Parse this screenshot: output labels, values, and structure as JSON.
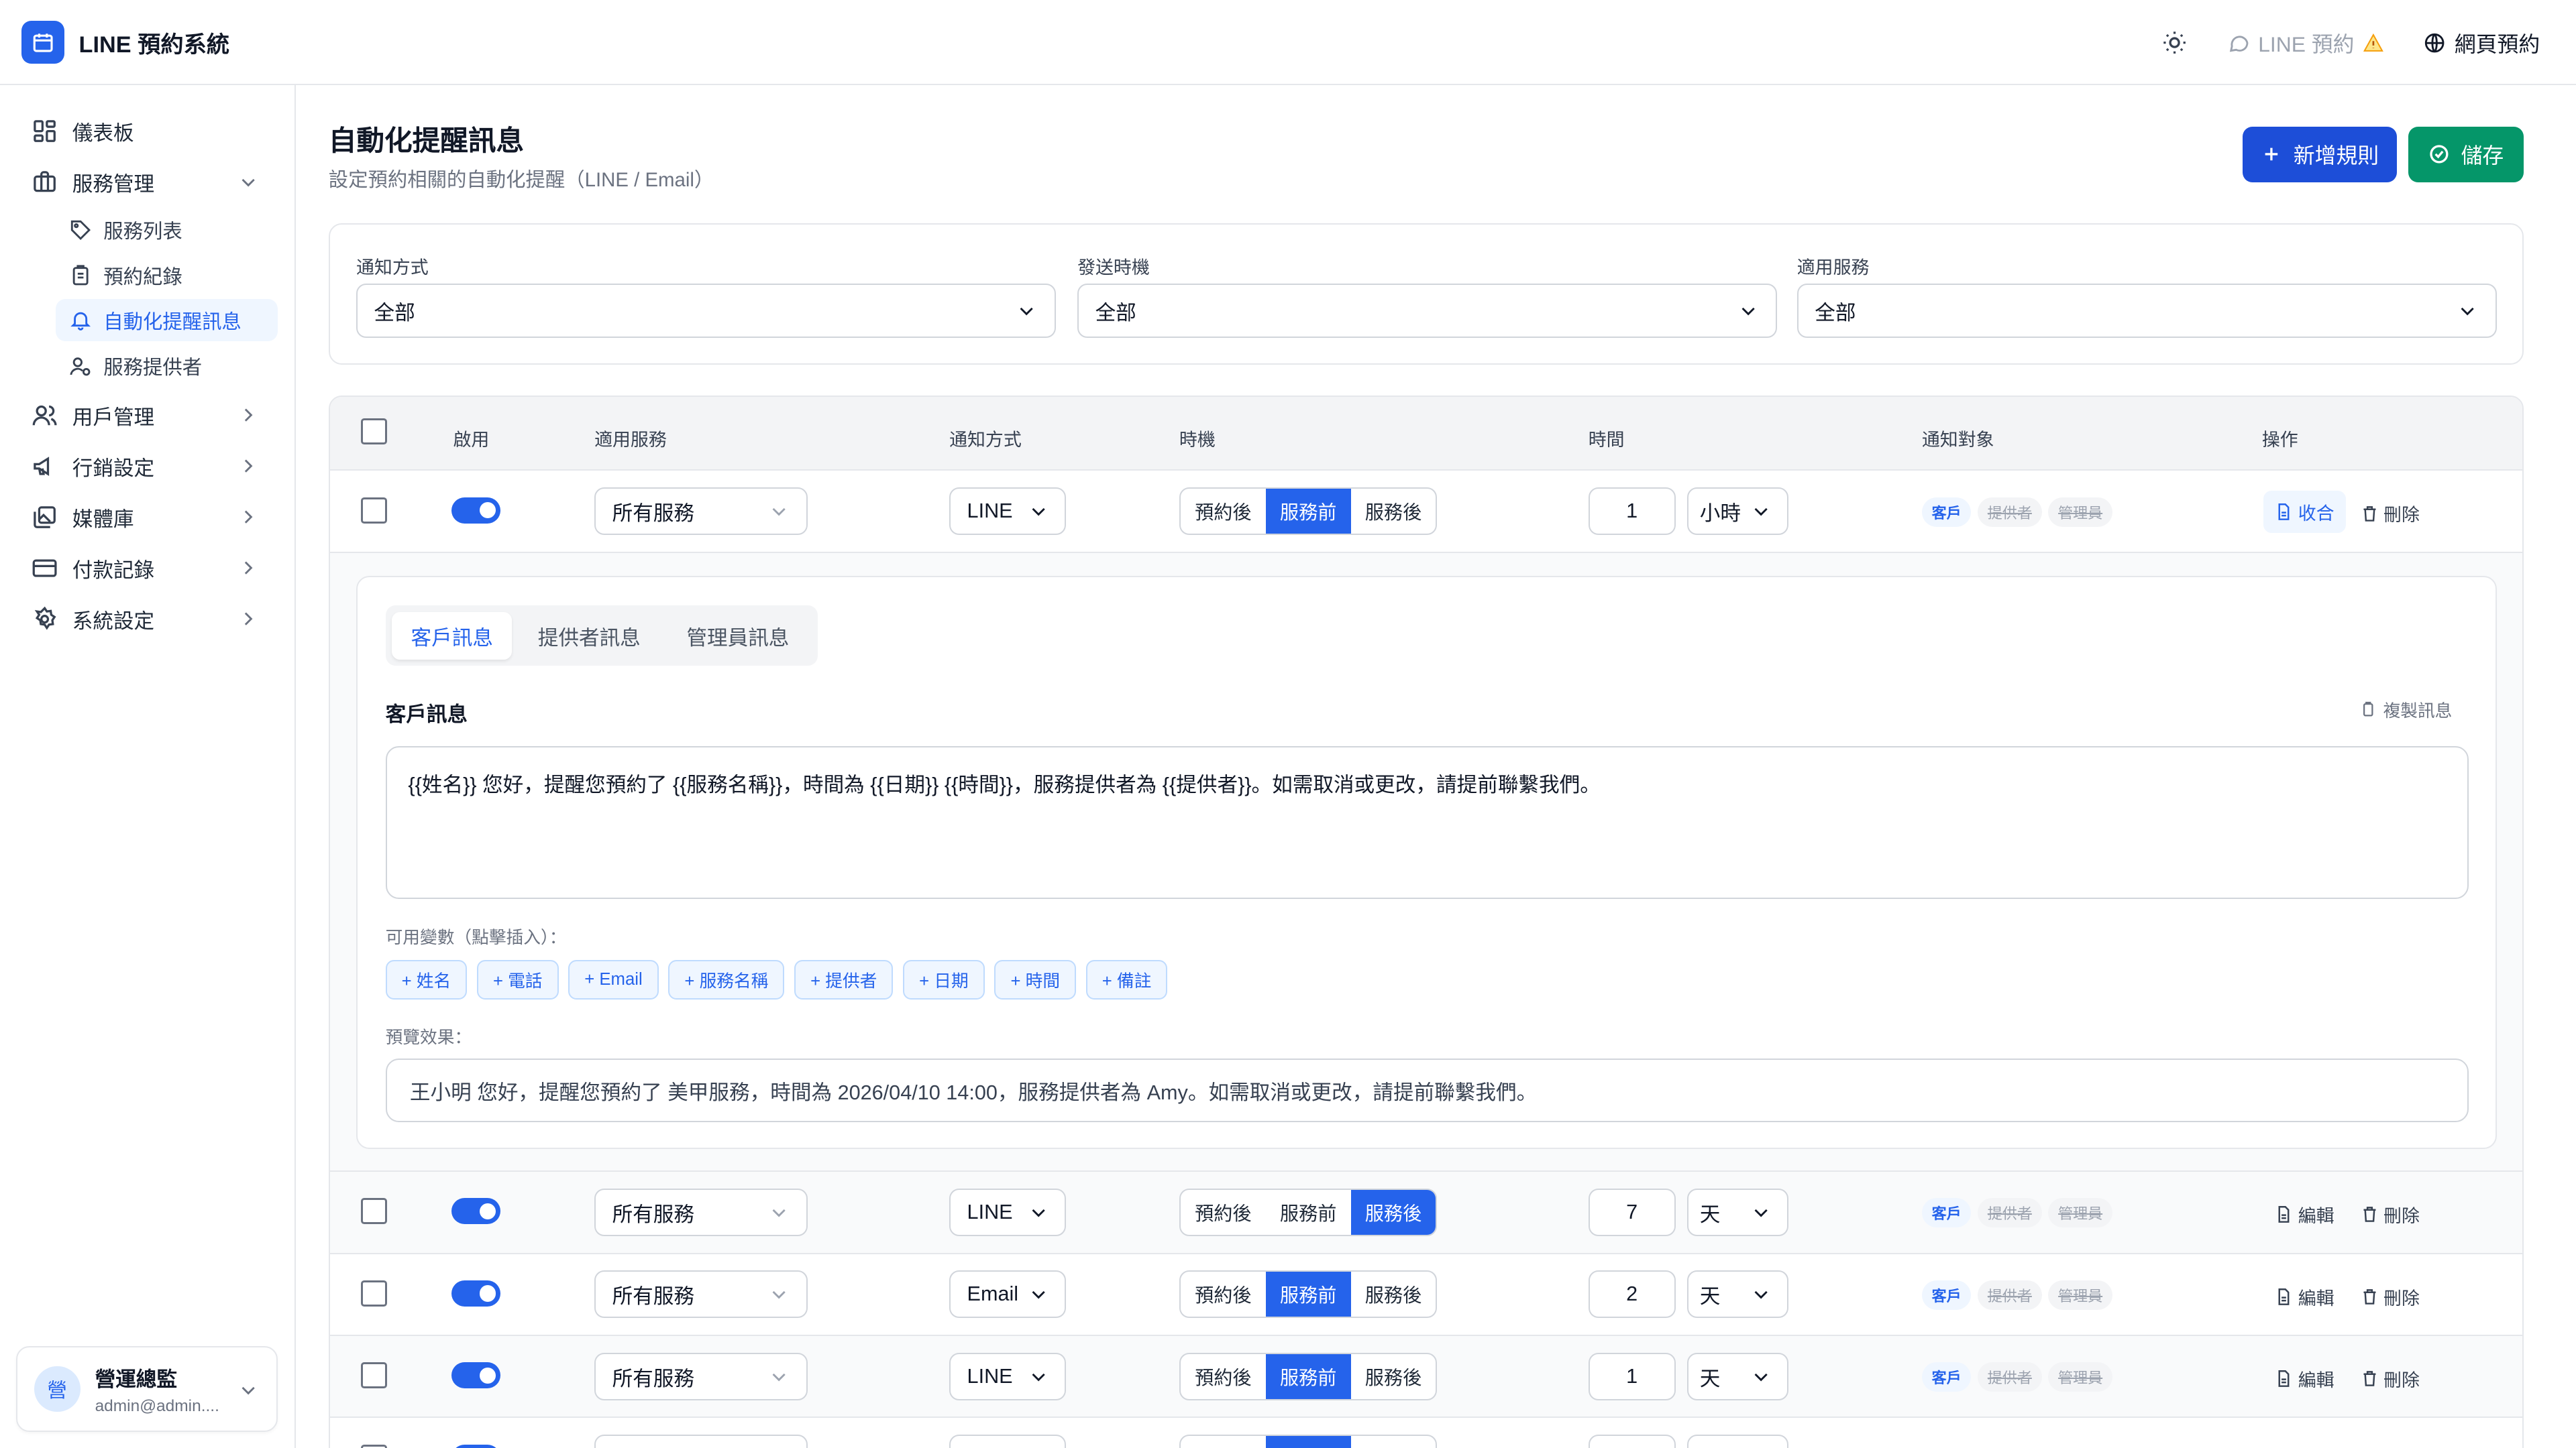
{
  "app": {
    "title": "LINE 預約系統"
  },
  "header": {
    "line_link": "LINE 預約",
    "web_link": "網頁預約"
  },
  "sidebar": {
    "items": [
      {
        "label": "儀表板"
      },
      {
        "label": "服務管理"
      },
      {
        "label": "用戶管理"
      },
      {
        "label": "行銷設定"
      },
      {
        "label": "媒體庫"
      },
      {
        "label": "付款記錄"
      },
      {
        "label": "系統設定"
      }
    ],
    "sub_items": [
      {
        "label": "服務列表"
      },
      {
        "label": "預約紀錄"
      },
      {
        "label": "自動化提醒訊息"
      },
      {
        "label": "服務提供者"
      }
    ],
    "user": {
      "avatar": "營",
      "name": "營運總監",
      "email": "admin@admin...."
    }
  },
  "page": {
    "title": "自動化提醒訊息",
    "subtitle": "設定預約相關的自動化提醒（LINE / Email）",
    "new_rule": "新增規則",
    "save": "儲存"
  },
  "filters": [
    {
      "label": "通知方式",
      "value": "全部"
    },
    {
      "label": "發送時機",
      "value": "全部"
    },
    {
      "label": "適用服務",
      "value": "全部"
    }
  ],
  "table": {
    "headers": [
      "啟用",
      "適用服務",
      "通知方式",
      "時機",
      "時間",
      "通知對象",
      "操作"
    ],
    "timing_options": [
      "預約後",
      "服務前",
      "服務後"
    ],
    "targets": [
      "客戶",
      "提供者",
      "管理員"
    ],
    "rows": [
      {
        "enabled": true,
        "service": "所有服務",
        "channel": "LINE",
        "timing": "服務前",
        "amount": "1",
        "unit": "小時",
        "action": "收合",
        "delete": "刪除"
      },
      {
        "enabled": true,
        "service": "所有服務",
        "channel": "LINE",
        "timing": "服務後",
        "amount": "7",
        "unit": "天",
        "action": "編輯",
        "delete": "刪除"
      },
      {
        "enabled": true,
        "service": "所有服務",
        "channel": "Email",
        "timing": "服務前",
        "amount": "2",
        "unit": "天",
        "action": "編輯",
        "delete": "刪除"
      },
      {
        "enabled": true,
        "service": "所有服務",
        "channel": "LINE",
        "timing": "服務前",
        "amount": "1",
        "unit": "天",
        "action": "編輯",
        "delete": "刪除"
      }
    ]
  },
  "editor": {
    "tabs": [
      "客戶訊息",
      "提供者訊息",
      "管理員訊息"
    ],
    "section_title": "客戶訊息",
    "copy_label": "複製訊息",
    "message": "{{姓名}} 您好，提醒您預約了 {{服務名稱}}，時間為 {{日期}} {{時間}}，服務提供者為 {{提供者}}。如需取消或更改，請提前聯繫我們。",
    "vars_label": "可用變數（點擊插入）：",
    "vars": [
      "+ 姓名",
      "+ 電話",
      "+ Email",
      "+ 服務名稱",
      "+ 提供者",
      "+ 日期",
      "+ 時間",
      "+ 備註"
    ],
    "preview_label": "預覽效果：",
    "preview": "王小明 您好，提醒您預約了 美甲服務，時間為 2026/04/10 14:00，服務提供者為 Amy。如需取消或更改，請提前聯繫我們。"
  },
  "colors": {
    "primary": "#2563eb",
    "save": "#059669",
    "new_button": "#1d4ed8"
  }
}
